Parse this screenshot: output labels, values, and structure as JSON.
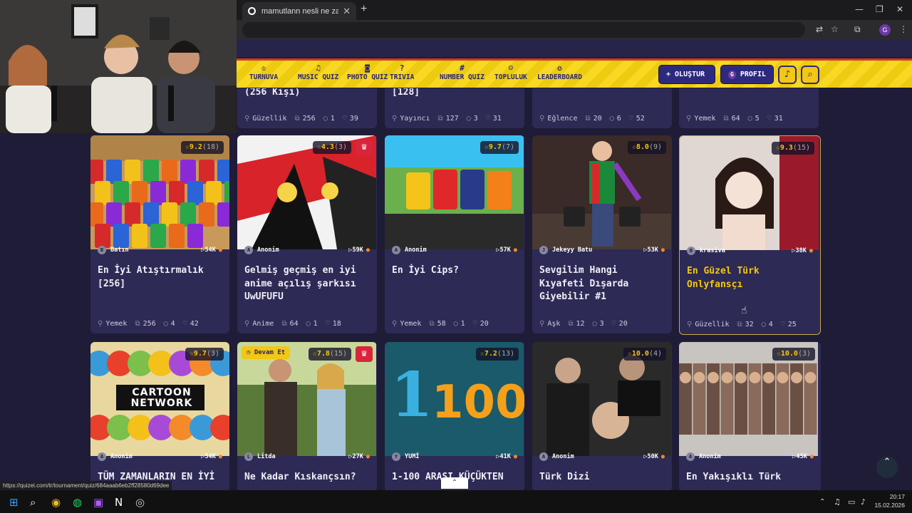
{
  "browser": {
    "tab_title": "mamutlann nesli ne zaman tük",
    "status_url": "https://quizei.com/tr/tournament/quiz/684aaab6eb2ff28580d69dee"
  },
  "nav": {
    "items": [
      {
        "label": "TURNUVA",
        "icon": "trophy-icon"
      },
      {
        "label": "MUSIC QUIZ",
        "icon": "music-note-icon"
      },
      {
        "label": "PHOTO QUIZ",
        "icon": "camera-icon"
      },
      {
        "label": "TRIVIA",
        "icon": "question-icon"
      },
      {
        "label": "NUMBER QUIZ",
        "icon": "hash-icon"
      },
      {
        "label": "TOPLULUK",
        "icon": "people-icon"
      },
      {
        "label": "LEADERBOARD",
        "icon": "medal-icon"
      }
    ],
    "create_label": "OLUŞTUR",
    "profile_label": "PROFIL",
    "profile_initial": "G"
  },
  "top_row": [
    {
      "title": "(256 Kişi)",
      "category": "Güzellik",
      "items": "256",
      "comments": "1",
      "likes": "39"
    },
    {
      "title": "[128]",
      "category": "Yayıncı",
      "items": "127",
      "comments": "3",
      "likes": "31"
    },
    {
      "title": "",
      "category": "Eğlence",
      "items": "20",
      "comments": "6",
      "likes": "52"
    },
    {
      "title": "",
      "category": "Yemek",
      "items": "64",
      "comments": "5",
      "likes": "31"
    }
  ],
  "row1": [
    {
      "rating": "9.2",
      "count": "(18)",
      "author": "Batın",
      "author_initial": "B",
      "plays": "54K",
      "title": "En İyi Atıştırmalık [256]",
      "category": "Yemek",
      "items": "256",
      "comments": "4",
      "likes": "42"
    },
    {
      "rating": "4.3",
      "count": "(3)",
      "author": "Anonim",
      "author_initial": "A",
      "plays": "59K",
      "title": "Gelmiş geçmiş en iyi anime açılış şarkısı UwUFUFU",
      "category": "Anime",
      "items": "64",
      "comments": "1",
      "likes": "18"
    },
    {
      "rating": "9.7",
      "count": "(7)",
      "author": "Anonim",
      "author_initial": "A",
      "plays": "57K",
      "title": "En İyi Cips?",
      "category": "Yemek",
      "items": "58",
      "comments": "1",
      "likes": "20"
    },
    {
      "rating": "8.0",
      "count": "(9)",
      "author": "Jekeyy Batu",
      "author_initial": "J",
      "plays": "53K",
      "title": "Sevgilim Hangi Kıyafeti Dışarda Giyebilir #1",
      "category": "Aşk",
      "items": "12",
      "comments": "3",
      "likes": "20"
    },
    {
      "rating": "9.3",
      "count": "(15)",
      "author": "krasiva",
      "author_initial": "B",
      "plays": "38K",
      "title": "En Güzel Türk Onlyfansçı",
      "category": "Güzellik",
      "items": "32",
      "comments": "4",
      "likes": "25"
    }
  ],
  "row2": [
    {
      "rating": "9.7",
      "count": "(3)",
      "author": "Anonim",
      "author_initial": "A",
      "plays": "54K",
      "title": "TÜM ZAMANLARIN EN İYİ"
    },
    {
      "rating": "7.8",
      "count": "(15)",
      "author": "Litda",
      "author_initial": "L",
      "plays": "27K",
      "title": "Ne Kadar Kıskançsın?",
      "badge": "Devam Et"
    },
    {
      "rating": "7.2",
      "count": "(13)",
      "author": "YUMİ",
      "author_initial": "Y",
      "plays": "41K",
      "title": "1-100 ARASI KÜÇÜKTEN"
    },
    {
      "rating": "10.0",
      "count": "(4)",
      "author": "Anonim",
      "author_initial": "A",
      "plays": "50K",
      "title": "Türk Dizi"
    },
    {
      "rating": "10.0",
      "count": "(3)",
      "author": "Anonim",
      "author_initial": "A",
      "plays": "45K",
      "title": "En Yakışıklı Türk"
    }
  ],
  "thumb_text": {
    "cartoon": "CARTOON NETWORK",
    "numbers": "100",
    "number_one": "1"
  },
  "taskbar": {
    "time": "20:17",
    "date": "15.02.2026"
  },
  "colors": {
    "accent_yellow": "#f3c712",
    "nav_blue": "#2d2a7e",
    "card_bg": "#2d2a55",
    "page_bg": "#1f1c38"
  }
}
